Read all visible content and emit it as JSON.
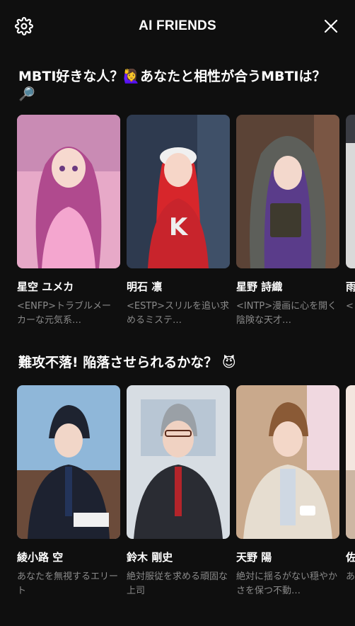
{
  "header": {
    "title": "AI FRIENDS",
    "settings_icon": "gear-icon",
    "close_icon": "close-icon"
  },
  "sections": [
    {
      "title": "MBTI好きな人？🙋‍♀️あなたと相性が合うMBTIは？🔎",
      "cards": [
        {
          "name": "星空 ユメカ",
          "desc": "<ENFP>トラブルメーカーな元気系…"
        },
        {
          "name": "明石 凛",
          "desc": "<ESTP>スリルを追い求めるミステ…"
        },
        {
          "name": "星野 詩織",
          "desc": "<INTP>漫画に心を開く陰険な天才…"
        },
        {
          "name": "雨",
          "desc": "<"
        }
      ]
    },
    {
      "title": "難攻不落! 陥落させられるかな？ 😈",
      "cards": [
        {
          "name": "綾小路 空",
          "desc": "あなたを無視するエリート"
        },
        {
          "name": "鈴木 剛史",
          "desc": "絶対服従を求める頑固な上司"
        },
        {
          "name": "天野 陽",
          "desc": "絶対に揺るがない穏やかさを保つ不動…"
        },
        {
          "name": "佐",
          "desc": "あ"
        }
      ]
    }
  ],
  "colors": {
    "background": "#0f0f0f",
    "text": "#ffffff",
    "subtext": "#8a8a8a"
  }
}
